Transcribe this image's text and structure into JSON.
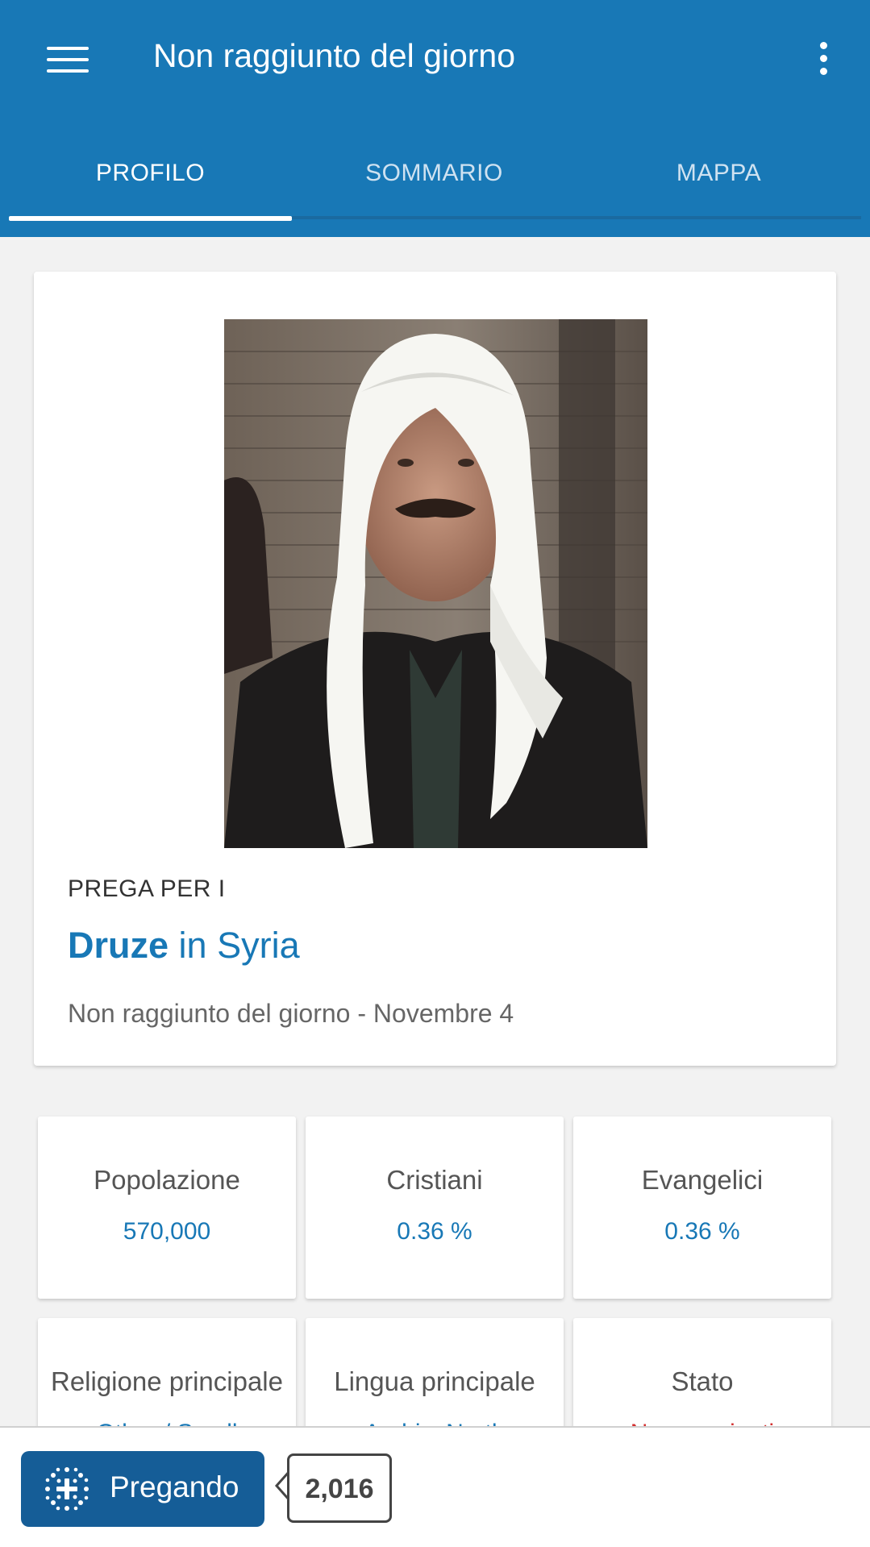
{
  "appbar": {
    "title": "Non raggiunto del giorno"
  },
  "tabs": [
    {
      "label": "PROFILO",
      "active": true
    },
    {
      "label": "SOMMARIO",
      "active": false
    },
    {
      "label": "MAPPA",
      "active": false
    }
  ],
  "profile": {
    "pray_label": "PREGA PER I",
    "people_name": "Druze",
    "location": "in Syria",
    "subtitle": "Non raggiunto del giorno - Novembre 4"
  },
  "stats": [
    {
      "label": "Popolazione",
      "value": "570,000"
    },
    {
      "label": "Cristiani",
      "value": "0.36 %"
    },
    {
      "label": "Evangelici",
      "value": "0.36 %"
    },
    {
      "label": "Religione principale",
      "value": "Other / Small"
    },
    {
      "label": "Lingua principale",
      "value": "Arabic, North"
    },
    {
      "label": "Stato",
      "value": "Non raggiunti"
    }
  ],
  "bottom": {
    "pray_button": "Pregando",
    "pray_count": "2,016"
  },
  "colors": {
    "primary": "#1878b6",
    "button_dark": "#155d97",
    "status_red": "#d32f2f"
  },
  "icons": [
    "menu-icon",
    "more-vert-icon",
    "prayer-icon"
  ]
}
